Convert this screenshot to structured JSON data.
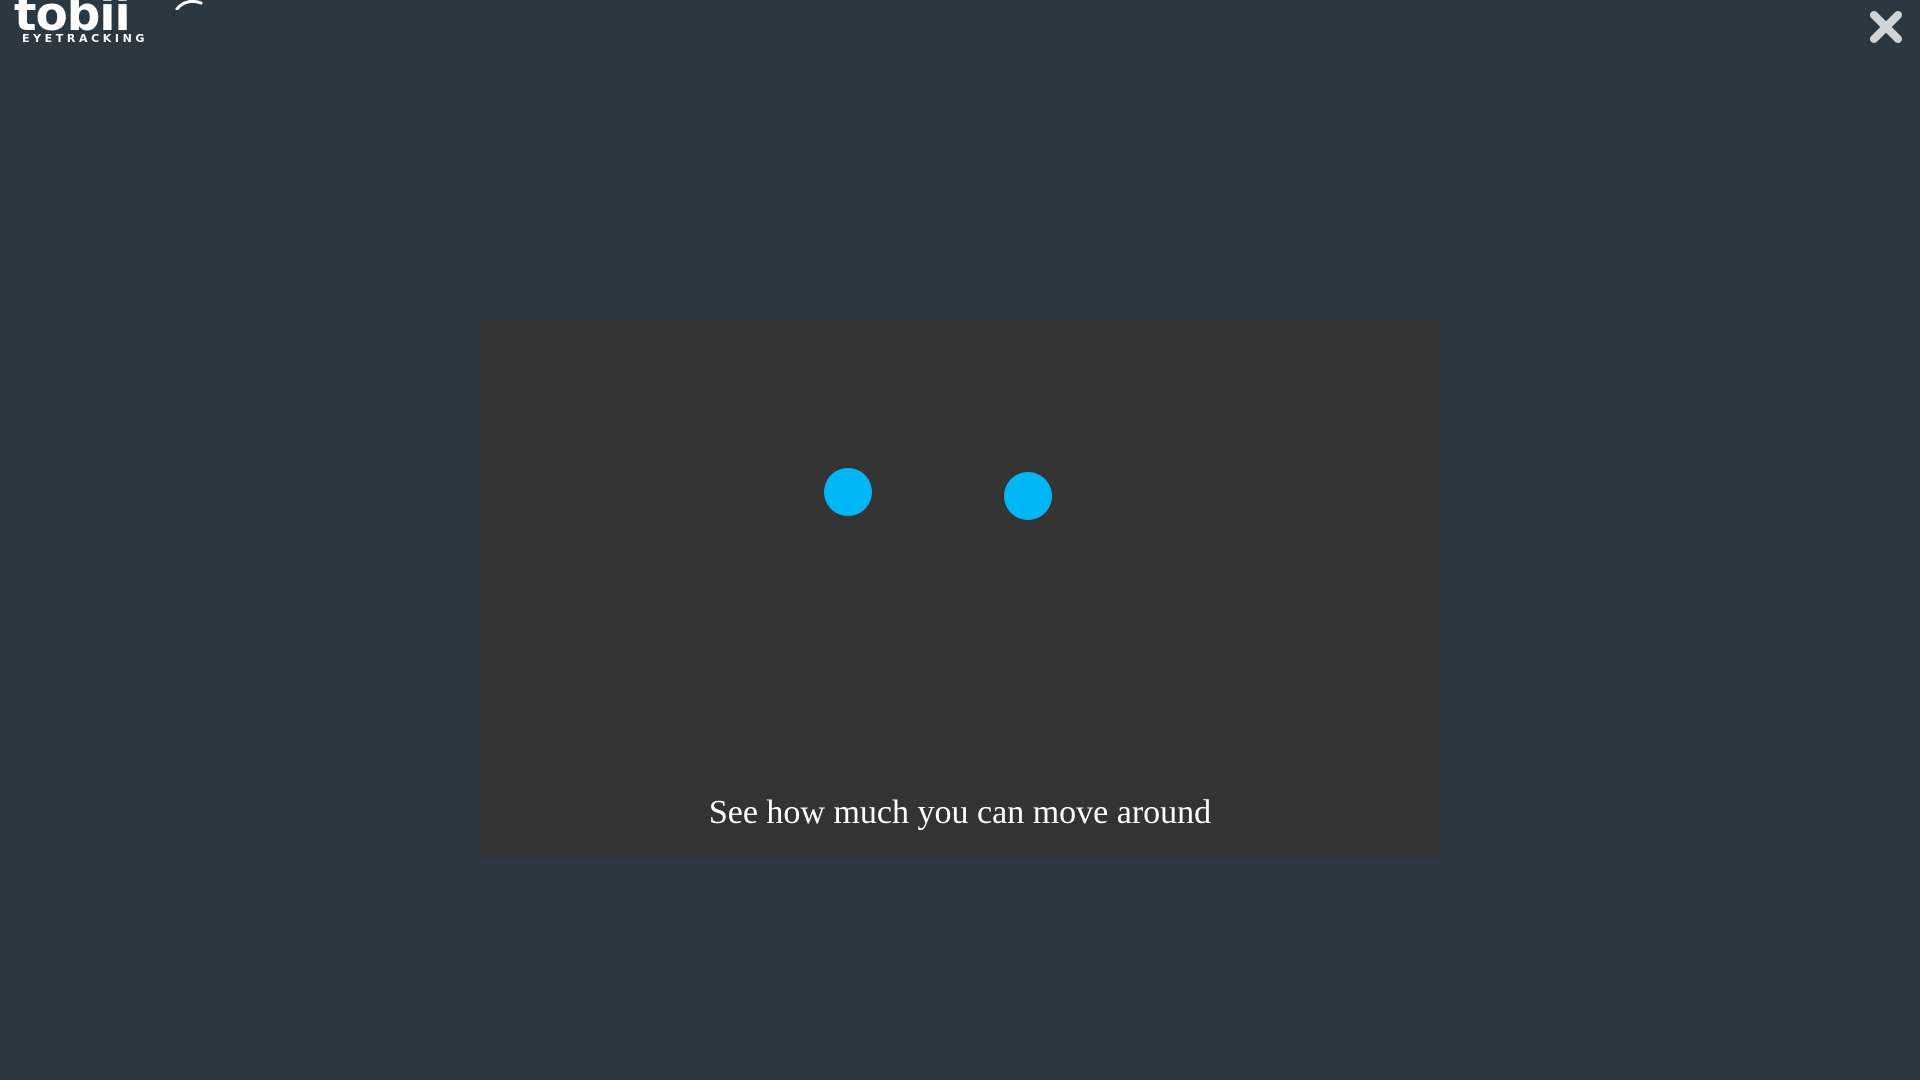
{
  "app": {
    "logo_text": "tobii",
    "logo_subtext": "EYETRACKING"
  },
  "toolbar": {
    "close_icon": "close-icon"
  },
  "status_panel": {
    "instruction": "See how much you can move around",
    "eye_indicator_color": "#00b6f5",
    "panel_color": "#333333"
  },
  "colors": {
    "background": "#2b3841",
    "text": "#ffffff",
    "close_icon": "#d0d4d7"
  }
}
